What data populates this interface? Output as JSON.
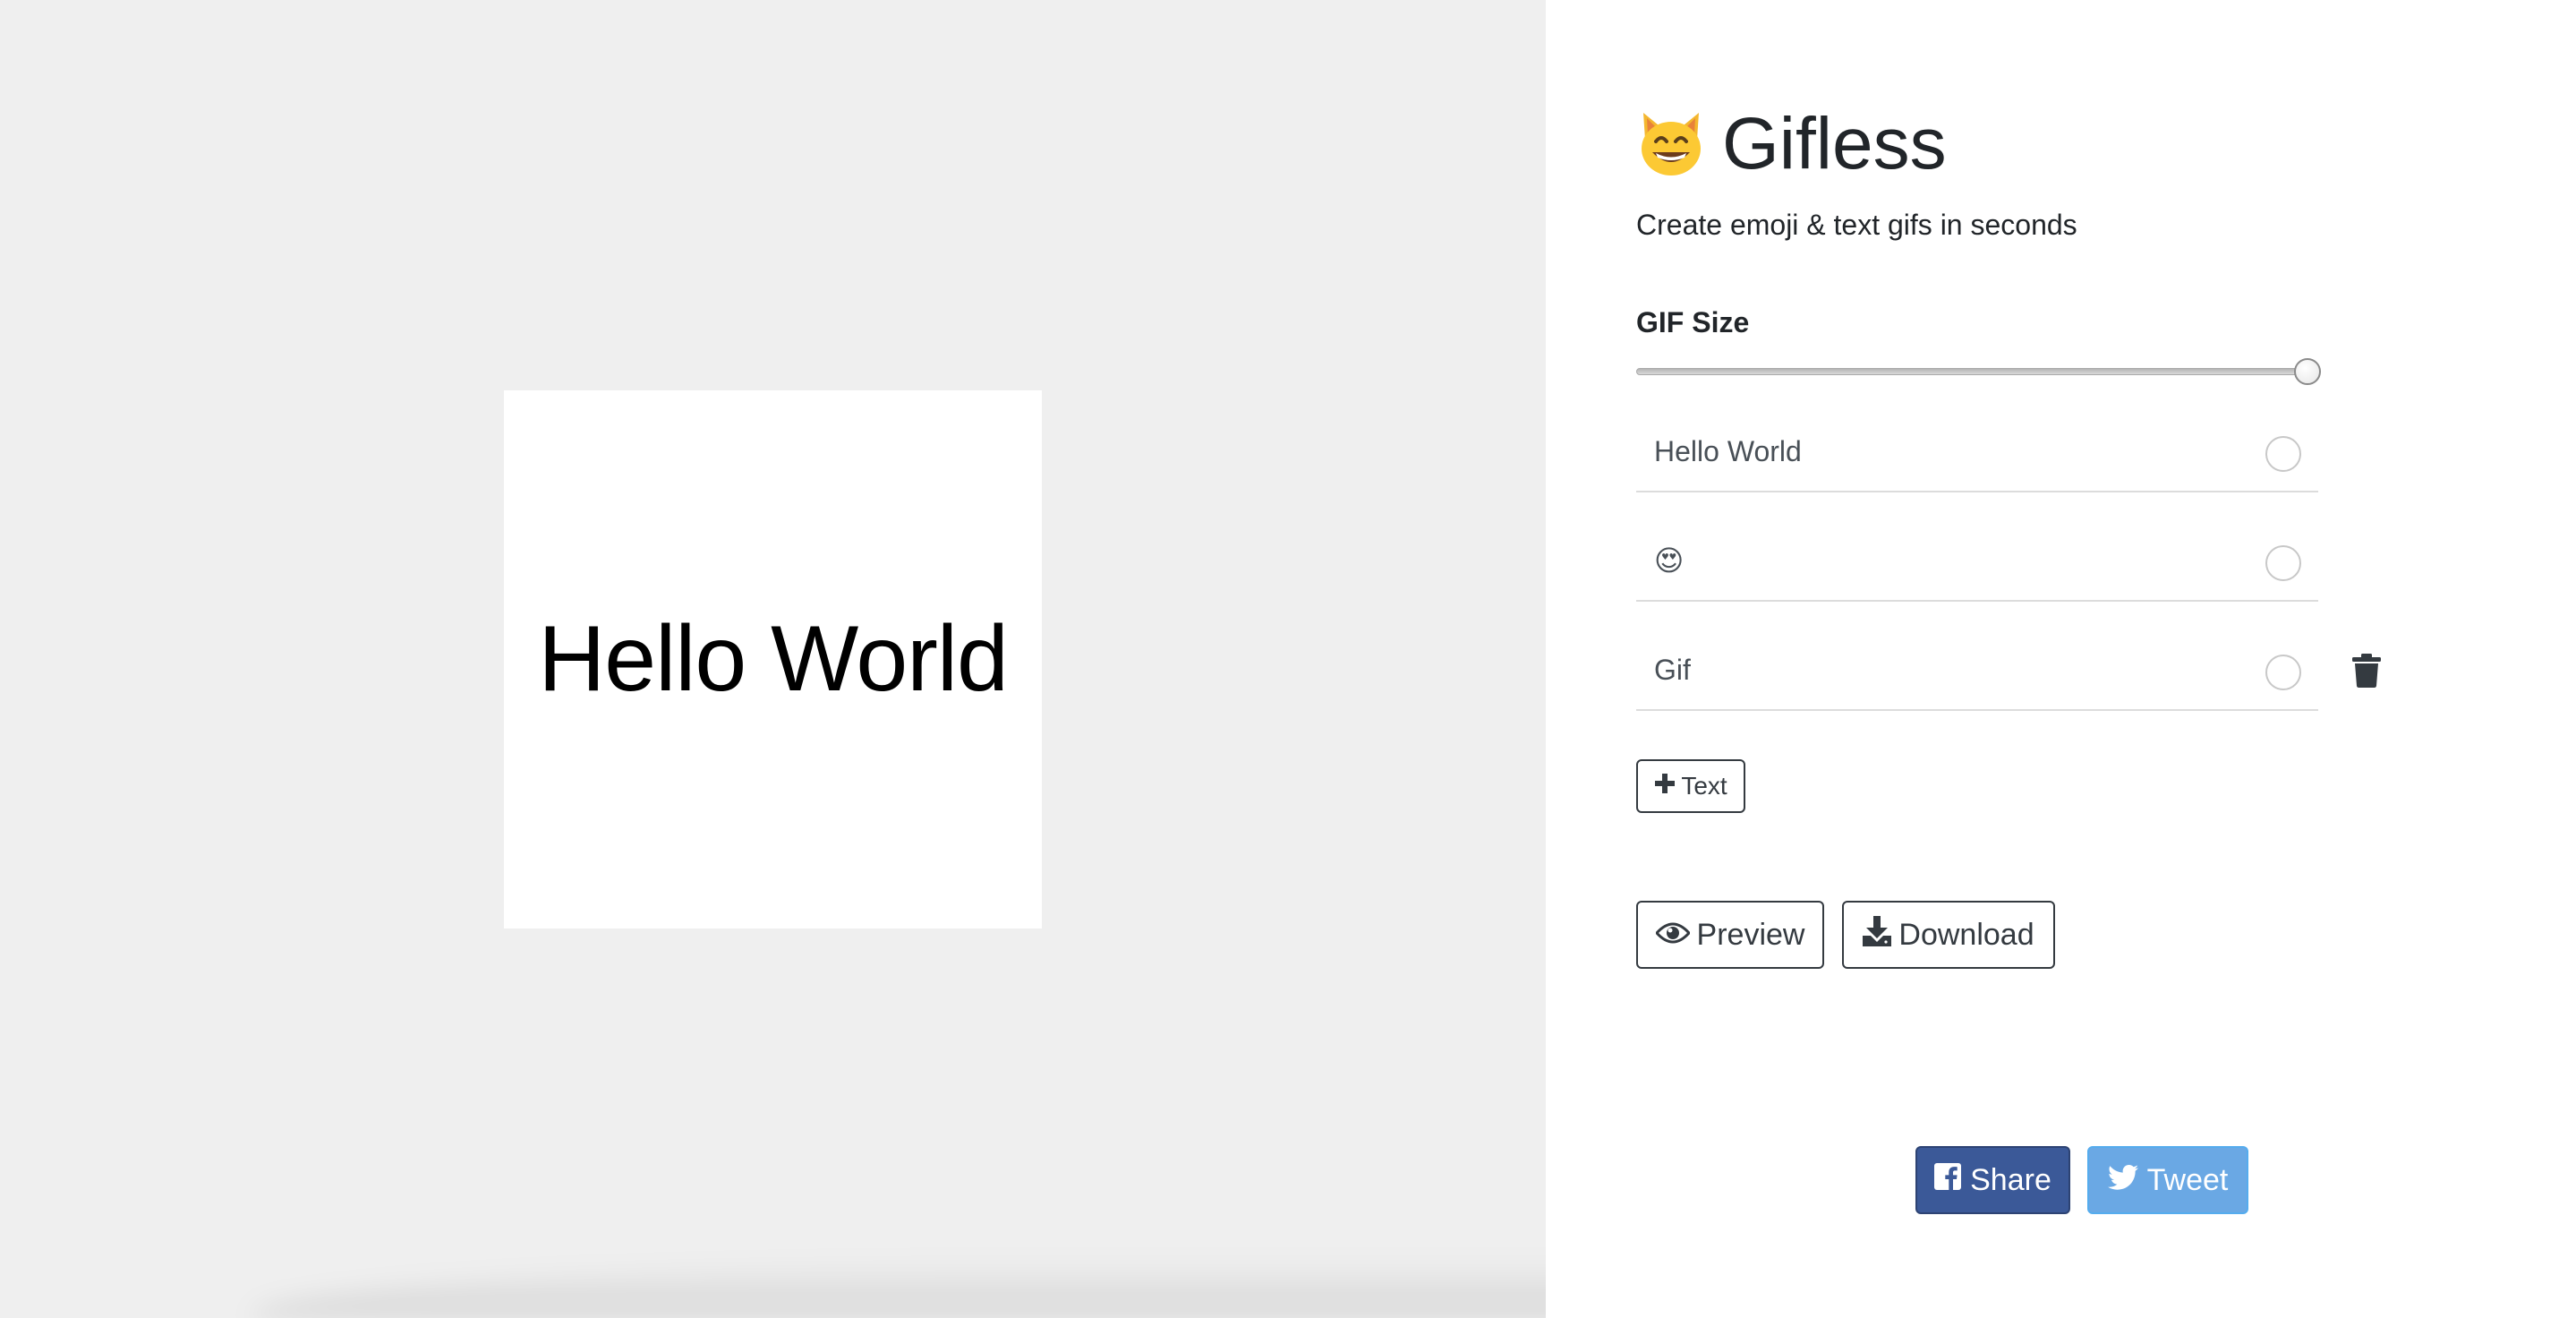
{
  "app": {
    "title": "Gifless",
    "subtitle": "Create emoji & text gifs in seconds"
  },
  "canvas": {
    "preview_text": "Hello World"
  },
  "settings": {
    "size_label": "GIF Size",
    "size_slider_fraction": 1.0
  },
  "layers": [
    {
      "text": "Hello World",
      "selected": false
    },
    {
      "text": "😍",
      "selected": false
    },
    {
      "text": "Gif",
      "selected": false
    }
  ],
  "buttons": {
    "add_text": "Text",
    "preview": "Preview",
    "download": "Download",
    "share": "Share",
    "tweet": "Tweet"
  },
  "icons": {
    "title": "grinning-cat-emoji",
    "add": "plus-icon",
    "preview": "eye-icon",
    "download": "download-icon",
    "share": "facebook-icon",
    "tweet": "twitter-icon",
    "delete": "trash-icon"
  },
  "colors": {
    "facebook": "#3b5998",
    "twitter": "#6aa8e4",
    "left_background": "#efefef"
  }
}
